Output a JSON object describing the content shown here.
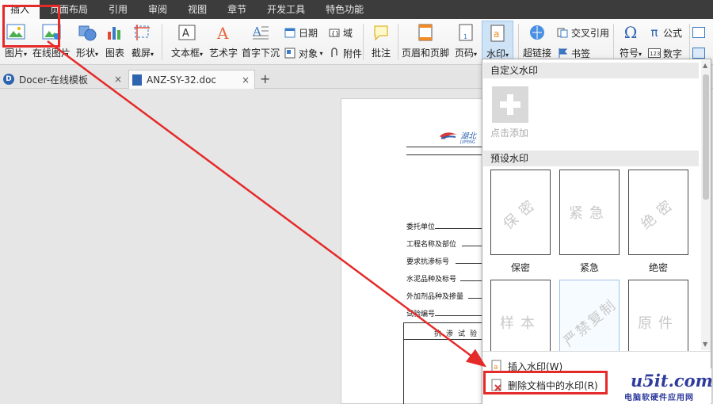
{
  "menubar": [
    "插入",
    "页面布局",
    "引用",
    "审阅",
    "视图",
    "章节",
    "开发工具",
    "特色功能"
  ],
  "ribbon": {
    "picture": "图片",
    "online_picture": "在线图片",
    "shape": "形状",
    "chart": "图表",
    "screenshot": "截屏",
    "textbox": "文本框",
    "wordart": "艺术字",
    "dropcap": "首字下沉",
    "date": "日期",
    "object": "对象",
    "field": "域",
    "attachment": "附件",
    "comment": "批注",
    "header_footer": "页眉和页脚",
    "page_number": "页码",
    "watermark": "水印",
    "hyperlink": "超链接",
    "cross_ref": "交叉引用",
    "bookmark": "书签",
    "symbol": "符号",
    "formula": "公式",
    "number": "数字"
  },
  "tabs": {
    "docer": "Docer-在线模板",
    "doc": "ANZ-SY-32.doc",
    "close": "×",
    "new": "+"
  },
  "document": {
    "logo_text": "湖北",
    "logo_sub": "JUFENG",
    "fields": [
      "委托单位",
      "工程名称及部位",
      "要求抗渗标号",
      "水泥品种及标号",
      "外加剂品种及掺量",
      "试验编号"
    ],
    "table_header": "抗渗试验"
  },
  "watermark_panel": {
    "custom_header": "自定义水印",
    "add_label": "点击添加",
    "preset_header": "预设水印",
    "presets": [
      {
        "text": "保密",
        "label": "保密"
      },
      {
        "text": "紧急",
        "label": "紧急"
      },
      {
        "text": "绝密",
        "label": "绝密"
      },
      {
        "text": "样本",
        "label": ""
      },
      {
        "text": "严禁复制",
        "label": ""
      },
      {
        "text": "原件",
        "label": ""
      }
    ],
    "insert": "插入水印(W)",
    "remove": "删除文档中的水印(R)"
  },
  "brand": {
    "logo": "u5it.com",
    "subtitle": "电脑软硬件应用网"
  },
  "colors": {
    "accent": "#e52a2a",
    "menubar": "#3c3c3c",
    "highlight": "#cfe3f7"
  }
}
